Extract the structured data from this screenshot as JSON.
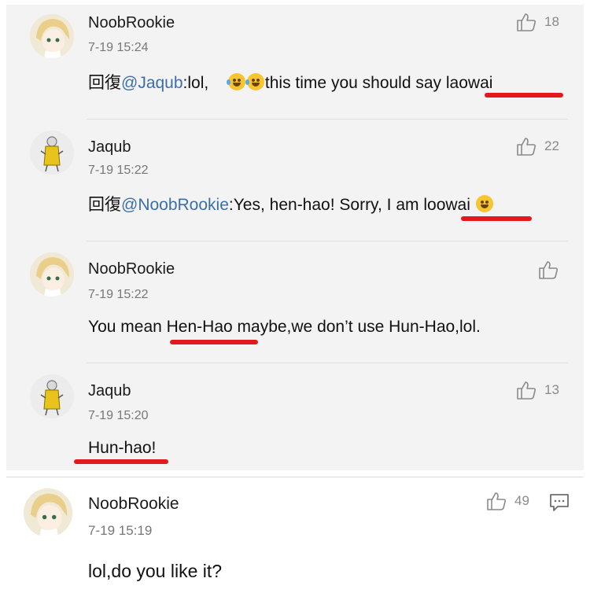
{
  "comments": [
    {
      "author": "NoobRookie",
      "time": "7-19 15:24",
      "likes": "18",
      "reply_prefix": "回復",
      "mention": "@Jaqub",
      "text_a": ":lol,",
      "emoji_icons": [
        "laughing-tears-emoji-icon",
        "laughing-tears-emoji-icon"
      ],
      "text_b": "this time you should say ",
      "highlight": "laowai"
    },
    {
      "author": "Jaqub",
      "time": "7-19 15:22",
      "likes": "22",
      "reply_prefix": "回復",
      "mention": "@NoobRookie",
      "text_a": ":Yes, hen-hao! Sorry, I am ",
      "highlight": "loowai",
      "emoji_icons": [
        "sweat-smile-emoji-icon"
      ]
    },
    {
      "author": "NoobRookie",
      "time": "7-19 15:22",
      "likes": "",
      "text_a": "You mean ",
      "highlight": "Hen-Hao",
      "text_b": " maybe,we don’t use Hun-Hao,lol."
    },
    {
      "author": "Jaqub",
      "time": "7-19 15:20",
      "likes": "13",
      "highlight": "Hun-hao!"
    },
    {
      "author": "NoobRookie",
      "time": "7-19 15:19",
      "likes": "49",
      "text_a": "lol,do you like it?"
    }
  ],
  "colors": {
    "mention": "#3c6fa8",
    "underline": "#e2191d",
    "panel_bg": "#f3f3f3"
  }
}
